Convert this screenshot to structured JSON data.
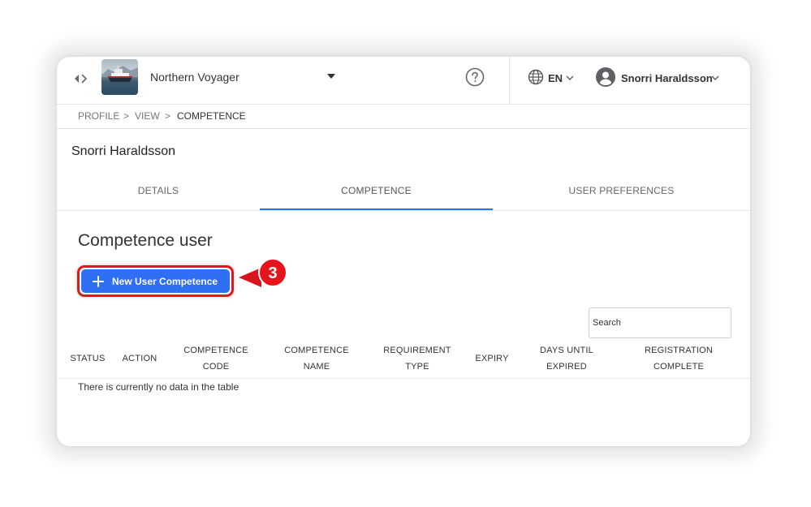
{
  "header": {
    "vessel_name": "Northern Voyager",
    "language": "EN",
    "user_name": "Snorri Haraldsson",
    "icons": {
      "nav": "nav-toggle-icon",
      "vessel_dropdown": "caret-down-icon",
      "help": "help-circle-icon",
      "language": "globe-icon",
      "user": "account-circle-icon",
      "chevron": "chevron-down-icon"
    }
  },
  "breadcrumb": {
    "items": [
      "PROFILE",
      "VIEW",
      "COMPETENCE"
    ],
    "separator": ">"
  },
  "profile": {
    "name": "Snorri Haraldsson"
  },
  "tabs": [
    {
      "label": "DETAILS",
      "active": false
    },
    {
      "label": "COMPETENCE",
      "active": true
    },
    {
      "label": "USER PREFERENCES",
      "active": false
    }
  ],
  "section": {
    "title": "Competence user",
    "new_button_label": "New User Competence"
  },
  "callout": {
    "step": "3"
  },
  "search": {
    "placeholder": "Search"
  },
  "table": {
    "columns": [
      {
        "line1": "STATUS",
        "line2": ""
      },
      {
        "line1": "ACTION",
        "line2": ""
      },
      {
        "line1": "COMPETENCE",
        "line2": "CODE"
      },
      {
        "line1": "COMPETENCE",
        "line2": "NAME"
      },
      {
        "line1": "REQUIREMENT",
        "line2": "TYPE"
      },
      {
        "line1": "EXPIRY",
        "line2": ""
      },
      {
        "line1": "DAYS UNTIL",
        "line2": "EXPIRED"
      },
      {
        "line1": "REGISTRATION",
        "line2": "COMPLETE"
      }
    ],
    "empty_message": "There is currently no data in the table"
  },
  "colors": {
    "accent": "#2f6ff4",
    "highlight": "#e8141c"
  }
}
